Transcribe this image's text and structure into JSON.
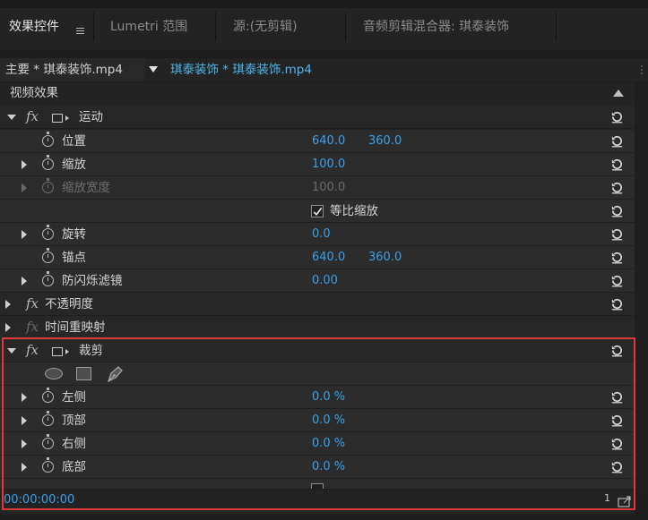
{
  "tabs": [
    {
      "label": "效果控件",
      "active": true
    },
    {
      "label": "Lumetri 范围",
      "active": false
    },
    {
      "label": "源:(无剪辑)",
      "active": false
    },
    {
      "label": "音频剪辑混合器: 琪泰装饰",
      "active": false
    }
  ],
  "clip_row": {
    "master_label": "主要 * 琪泰装饰.mp4",
    "sequence_label": "琪泰装饰 * 琪泰装饰.mp4"
  },
  "section_title": "视频效果",
  "motion": {
    "title": "运动",
    "position": {
      "label": "位置",
      "x": "640.0",
      "y": "360.0"
    },
    "scale": {
      "label": "缩放",
      "value": "100.0"
    },
    "scale_width": {
      "label": "缩放宽度",
      "value": "100.0"
    },
    "uniform_scale": {
      "label": "等比缩放",
      "checked": true
    },
    "rotation": {
      "label": "旋转",
      "value": "0.0"
    },
    "anchor": {
      "label": "锚点",
      "x": "640.0",
      "y": "360.0"
    },
    "antiflicker": {
      "label": "防闪烁滤镜",
      "value": "0.00"
    }
  },
  "opacity": {
    "title": "不透明度"
  },
  "time_remap": {
    "title": "时间重映射"
  },
  "crop": {
    "title": "裁剪",
    "left": {
      "label": "左侧",
      "value": "0.0 %"
    },
    "top": {
      "label": "顶部",
      "value": "0.0 %"
    },
    "right": {
      "label": "右侧",
      "value": "0.0 %"
    },
    "bottom": {
      "label": "底部",
      "value": "0.0 %"
    }
  },
  "footer": {
    "timecode": "00:00:00:00",
    "page": "1"
  },
  "colors": {
    "accent_blue": "#3aa0e8",
    "link_blue": "#4fb6e9",
    "highlight_red": "#e0383a"
  },
  "icons": [
    "menu-icon",
    "dropdown-triangle-icon",
    "stopwatch-icon",
    "reset-icon",
    "fx-icon",
    "mask-icon",
    "ellipse-mask-icon",
    "rectangle-mask-icon",
    "pen-mask-icon",
    "checkmark-icon",
    "export-icon"
  ]
}
